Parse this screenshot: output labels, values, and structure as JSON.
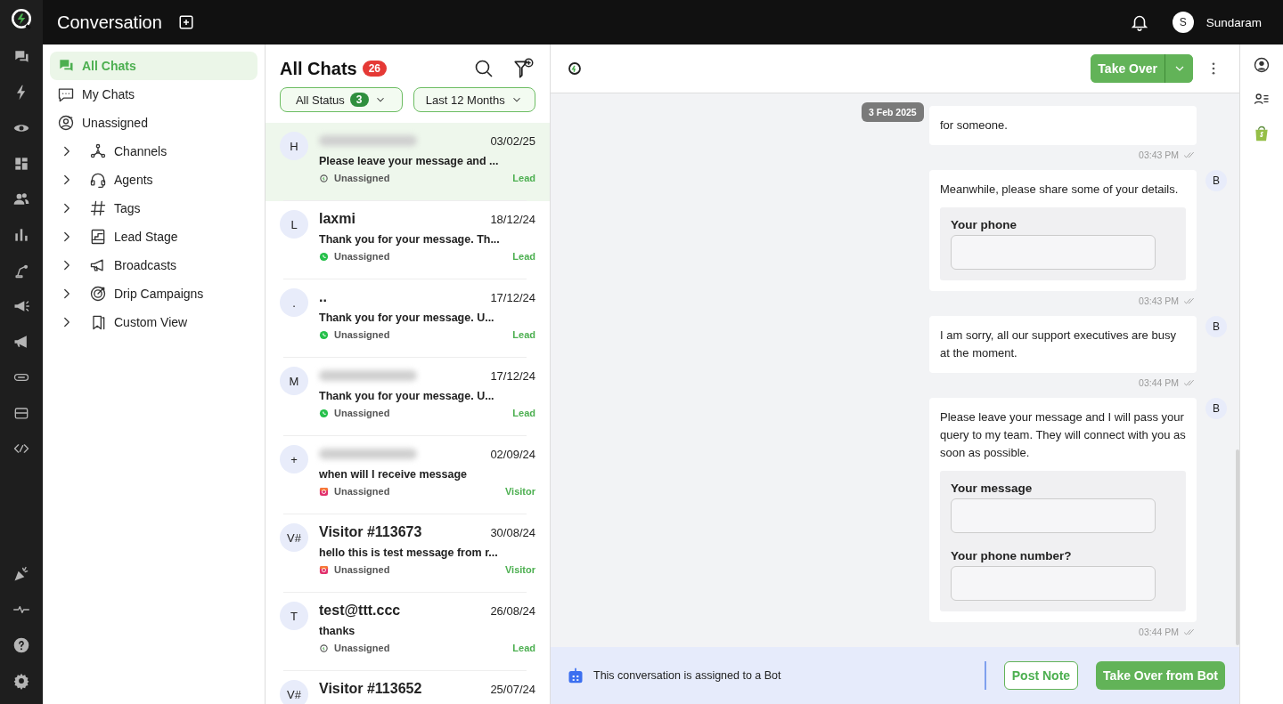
{
  "topbar": {
    "title": "Conversation",
    "user": {
      "initial": "S",
      "name": "Sundaram"
    }
  },
  "sidebar": {
    "items": [
      {
        "label": "All Chats",
        "selected": true
      },
      {
        "label": "My Chats",
        "selected": false
      },
      {
        "label": "Unassigned",
        "selected": false
      },
      {
        "label": "Channels",
        "selected": false,
        "expanded": false
      },
      {
        "label": "Agents",
        "selected": false,
        "expanded": false
      },
      {
        "label": "Tags",
        "selected": false,
        "expanded": false
      },
      {
        "label": "Lead Stage",
        "selected": false,
        "expanded": false
      },
      {
        "label": "Broadcasts",
        "selected": false,
        "expanded": false
      },
      {
        "label": "Drip Campaigns",
        "selected": false,
        "expanded": false
      },
      {
        "label": "Custom View",
        "selected": false,
        "expanded": false
      }
    ]
  },
  "chat_list": {
    "title": "All Chats",
    "count": "26",
    "filters": [
      {
        "label": "All Status",
        "count": "3"
      },
      {
        "label": "Last 12 Months"
      }
    ],
    "chats": [
      {
        "initial": "H",
        "name_blurred": true,
        "date": "03/02/25",
        "preview": "Please leave your message and ...",
        "kind": "web",
        "assignee": "Unassigned",
        "stage": "Lead",
        "selected": true
      },
      {
        "initial": "L",
        "name": "laxmi",
        "date": "18/12/24",
        "preview": "Thank you for your message. Th...",
        "kind": "whatsapp",
        "assignee": "Unassigned",
        "stage": "Lead",
        "selected": false
      },
      {
        "initial": ".",
        "name": "..",
        "date": "17/12/24",
        "preview": "Thank you for your message. U...",
        "kind": "whatsapp",
        "assignee": "Unassigned",
        "stage": "Lead",
        "selected": false
      },
      {
        "initial": "M",
        "name_blurred": true,
        "date": "17/12/24",
        "preview": "Thank you for your message. U...",
        "kind": "whatsapp",
        "assignee": "Unassigned",
        "stage": "Lead",
        "selected": false
      },
      {
        "initial": "+",
        "name_blurred": true,
        "date": "02/09/24",
        "preview": "when will I receive message",
        "kind": "instagram",
        "assignee": "Unassigned",
        "stage": "Visitor",
        "selected": false
      },
      {
        "initial": "V#",
        "name": "Visitor #113673",
        "date": "30/08/24",
        "preview": "hello this is test message from r...",
        "kind": "instagram",
        "assignee": "Unassigned",
        "stage": "Visitor",
        "selected": false
      },
      {
        "initial": "T",
        "name": "test@ttt.ccc",
        "date": "26/08/24",
        "preview": "thanks",
        "kind": "web",
        "assignee": "Unassigned",
        "stage": "Lead",
        "selected": false
      },
      {
        "initial": "V#",
        "name": "Visitor #113652",
        "date": "25/07/24"
      }
    ]
  },
  "conversation": {
    "header": {
      "button": "Take Over"
    },
    "date_chip": "3 Feb 2025",
    "messages": [
      {
        "text": "for someone.",
        "time": "03:43 PM"
      },
      {
        "avatar": "B",
        "text": "Meanwhile, please share some of your details.",
        "fields": [
          {
            "label": "Your phone"
          }
        ],
        "time": "03:43 PM"
      },
      {
        "avatar": "B",
        "text": "I am sorry, all our support executives are busy at the moment.",
        "time": "03:44 PM"
      },
      {
        "avatar": "B",
        "text": "Please leave your message and I will pass your query to my team. They will connect with you as soon as possible.",
        "fields": [
          {
            "label": "Your message"
          },
          {
            "label": "Your phone number?"
          }
        ],
        "time": "03:44 PM"
      }
    ],
    "footer": {
      "notice": "This conversation is assigned to a Bot",
      "buttons": [
        {
          "label": "Post Note",
          "kind": "outline"
        },
        {
          "label": "Take Over from Bot",
          "kind": "primary"
        }
      ]
    }
  }
}
